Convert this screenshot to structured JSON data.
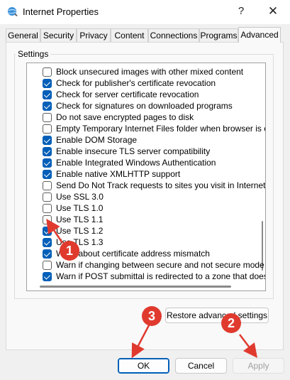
{
  "window": {
    "title": "Internet Properties",
    "help_glyph": "?",
    "close_glyph": "✕"
  },
  "tabs": [
    "General",
    "Security",
    "Privacy",
    "Content",
    "Connections",
    "Programs",
    "Advanced"
  ],
  "active_tab": "Advanced",
  "settings": {
    "group_label": "Settings",
    "items": [
      {
        "label": "Block unsecured images with other mixed content",
        "checked": false
      },
      {
        "label": "Check for publisher's certificate revocation",
        "checked": true
      },
      {
        "label": "Check for server certificate revocation",
        "checked": true
      },
      {
        "label": "Check for signatures on downloaded programs",
        "checked": true
      },
      {
        "label": "Do not save encrypted pages to disk",
        "checked": false
      },
      {
        "label": "Empty Temporary Internet Files folder when browser is clo",
        "checked": false
      },
      {
        "label": "Enable DOM Storage",
        "checked": true
      },
      {
        "label": "Enable insecure TLS server compatibility",
        "checked": true
      },
      {
        "label": "Enable Integrated Windows Authentication",
        "checked": true
      },
      {
        "label": "Enable native XMLHTTP support",
        "checked": true
      },
      {
        "label": "Send Do Not Track requests to sites you visit in Internet E",
        "checked": false
      },
      {
        "label": "Use SSL 3.0",
        "checked": false
      },
      {
        "label": "Use TLS 1.0",
        "checked": false
      },
      {
        "label": "Use TLS 1.1",
        "checked": false
      },
      {
        "label": "Use TLS 1.2",
        "checked": true
      },
      {
        "label": "Use TLS 1.3",
        "checked": true
      },
      {
        "label": "Warn about certificate address mismatch",
        "checked": true
      },
      {
        "label": "Warn if changing between secure and not secure mode",
        "checked": false
      },
      {
        "label": "Warn if POST submittal is redirected to a zone that does n",
        "checked": true
      }
    ]
  },
  "buttons": {
    "restore": "Restore advanced settings",
    "ok": "OK",
    "cancel": "Cancel",
    "apply": "Apply"
  },
  "annotations": {
    "badge_1": "1",
    "badge_2": "2",
    "badge_3": "3",
    "color": "#e03a2f"
  }
}
